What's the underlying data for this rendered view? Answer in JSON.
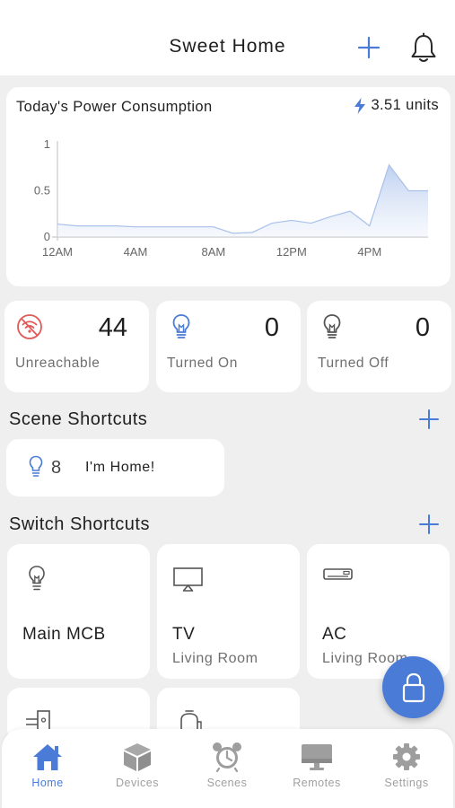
{
  "header": {
    "title": "Sweet Home"
  },
  "power": {
    "title": "Today's Power Consumption",
    "units_value": "3.51 units"
  },
  "chart_data": {
    "type": "area",
    "title": "Today's Power Consumption",
    "x_ticks": [
      "12AM",
      "4AM",
      "8AM",
      "12PM",
      "4PM"
    ],
    "y_ticks": [
      "0",
      "0.5",
      "1"
    ],
    "ylim": [
      0,
      1
    ],
    "x_hours": [
      0,
      1,
      2,
      3,
      4,
      5,
      6,
      7,
      8,
      9,
      10,
      11,
      12,
      13,
      14,
      15,
      16,
      17,
      18,
      19
    ],
    "values": [
      0.14,
      0.12,
      0.12,
      0.12,
      0.11,
      0.11,
      0.11,
      0.11,
      0.11,
      0.04,
      0.05,
      0.15,
      0.18,
      0.15,
      0.22,
      0.28,
      0.12,
      0.78,
      0.5,
      0.5
    ],
    "color": "#4a7bd6",
    "grid": false
  },
  "stats": [
    {
      "value": "44",
      "label": "Unreachable",
      "icon": "wifi-off-icon"
    },
    {
      "value": "0",
      "label": "Turned On",
      "icon": "bulb-on-icon"
    },
    {
      "value": "0",
      "label": "Turned Off",
      "icon": "bulb-off-icon"
    }
  ],
  "scene_section": {
    "title": "Scene Shortcuts",
    "items": [
      {
        "count": "8",
        "name": "I'm Home!"
      }
    ]
  },
  "switch_section": {
    "title": "Switch Shortcuts",
    "items": [
      {
        "name": "Main MCB",
        "room": "",
        "icon": "bulb-icon"
      },
      {
        "name": "TV",
        "room": "Living Room",
        "icon": "tv-icon"
      },
      {
        "name": "AC",
        "room": "Living Room",
        "icon": "ac-icon"
      },
      {
        "name": "",
        "room": "",
        "icon": "switch-device-icon"
      },
      {
        "name": "",
        "room": "",
        "icon": "appliance-icon"
      }
    ]
  },
  "nav": {
    "items": [
      {
        "label": "Home",
        "icon": "home-icon",
        "active": true
      },
      {
        "label": "Devices",
        "icon": "cube-icon",
        "active": false
      },
      {
        "label": "Scenes",
        "icon": "alarm-clock-icon",
        "active": false
      },
      {
        "label": "Remotes",
        "icon": "monitor-icon",
        "active": false
      },
      {
        "label": "Settings",
        "icon": "gear-icon",
        "active": false
      }
    ]
  },
  "colors": {
    "accent": "#4a7bd6",
    "warning": "#e05a5a",
    "background": "#efefef"
  }
}
